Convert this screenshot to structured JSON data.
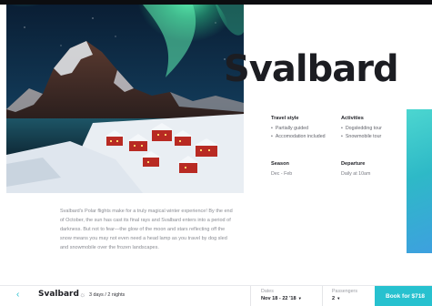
{
  "destination": {
    "title": "Svalbard"
  },
  "details": {
    "travel_style": {
      "heading": "Travel style",
      "items": [
        "Partially guided",
        "Accomodation included"
      ]
    },
    "activities": {
      "heading": "Activities",
      "items": [
        "Dogsledding tour",
        "Snowmobile tour"
      ]
    },
    "season": {
      "heading": "Season",
      "value": "Dec - Feb"
    },
    "departure": {
      "heading": "Departure",
      "value": "Daily at 10am"
    }
  },
  "description": "Svalbard's Polar flights make for a truly magical winter experience! By the end of October, the sun has cast its final rays and Svalbard enters into a period of darkness. But not to fear—the glow of the moon and stars reflecting off the snow means you may not even need a head lamp as you travel by dog sled and snowmobile over the frozen landscapes.",
  "booking_bar": {
    "back_icon": "‹",
    "title": "Svalbard",
    "sun_icon": "☼",
    "duration": "3 days / 2 nights",
    "dates_label": "Dates",
    "dates_value": "Nov 18 - 22 '18",
    "passengers_label": "Passengers",
    "passengers_value": "2",
    "caret": "▾",
    "book_label": "Book for $718"
  },
  "colors": {
    "accent": "#27c1cf",
    "title": "#1c1d22",
    "body_text": "#8a8c93"
  }
}
